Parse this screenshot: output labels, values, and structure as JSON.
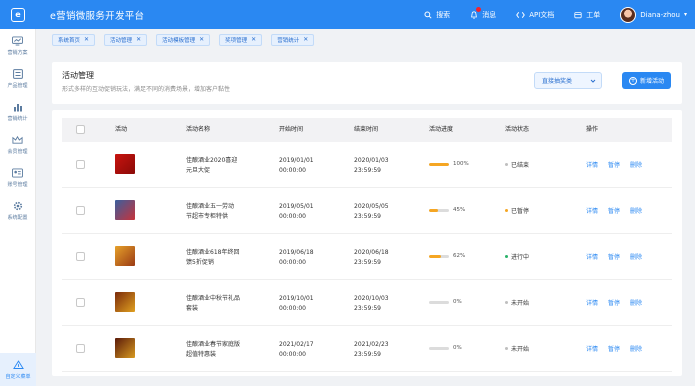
{
  "app": {
    "logo_text": "e",
    "title": "e营销微服务开发平台"
  },
  "topnav": {
    "search": "搜索",
    "messages": "消息",
    "api_docs": "API文档",
    "tickets": "工单",
    "user": "Diana-zhou"
  },
  "sidebar": {
    "items": [
      {
        "label": "营销方案",
        "icon": "chart-monitor-icon"
      },
      {
        "label": "产品管理",
        "icon": "list-icon"
      },
      {
        "label": "营销统计",
        "icon": "bar-chart-icon"
      },
      {
        "label": "会员管理",
        "icon": "crown-icon"
      },
      {
        "label": "账号管理",
        "icon": "user-card-icon"
      },
      {
        "label": "系统配置",
        "icon": "gear-icon"
      }
    ],
    "bottom": {
      "label": "自定义菜单",
      "icon": "custom-menu-icon"
    }
  },
  "tags": [
    "系统首页",
    "活动管理",
    "活动模板管理",
    "奖项管理",
    "营销统计"
  ],
  "header": {
    "title": "活动管理",
    "desc": "形式多样的互动促销玩法，满足不同的消费场景，增加客户黏性",
    "select_value": "直接抽奖类",
    "new_button": "新增活动"
  },
  "table": {
    "columns": [
      "活动",
      "活动名称",
      "开始时间",
      "结束时间",
      "活动进度",
      "活动状态",
      "操作"
    ],
    "actions": [
      "详情",
      "暂停",
      "删除"
    ],
    "rows": [
      {
        "name_line1": "佳酿酒业2020喜迎",
        "name_line2": "元旦大促",
        "start_date": "2019/01/01",
        "start_time": "00:00:00",
        "end_date": "2020/01/03",
        "end_time": "23:59:59",
        "progress": 100,
        "progress_label": "100%",
        "status": "已结束",
        "status_color": "#bfbfbf",
        "thumb": [
          "#c8140f",
          "#8a0a07"
        ]
      },
      {
        "name_line1": "佳酿酒业五一劳动",
        "name_line2": "节超市专柜特供",
        "start_date": "2019/05/01",
        "start_time": "00:00:00",
        "end_date": "2020/05/05",
        "end_time": "23:59:59",
        "progress": 45,
        "progress_label": "45%",
        "status": "已暂停",
        "status_color": "#f5a623",
        "thumb": [
          "#3a5f9e",
          "#c8323a"
        ]
      },
      {
        "name_line1": "佳酿酒业618年终回",
        "name_line2": "馈5折促销",
        "start_date": "2019/06/18",
        "start_time": "00:00:00",
        "end_date": "2020/06/18",
        "end_time": "23:59:59",
        "progress": 62,
        "progress_label": "62%",
        "status": "进行中",
        "status_color": "#2ab26a",
        "thumb": [
          "#e6a12a",
          "#9a3a14"
        ]
      },
      {
        "name_line1": "佳酿酒业中秋节礼品",
        "name_line2": "套装",
        "start_date": "2019/10/01",
        "start_time": "00:00:00",
        "end_date": "2020/10/03",
        "end_time": "23:59:59",
        "progress": 0,
        "progress_label": "0%",
        "status": "未开始",
        "status_color": "#bfbfbf",
        "thumb": [
          "#7a2a0a",
          "#e0a020"
        ]
      },
      {
        "name_line1": "佳酿酒业春节家庭版",
        "name_line2": "超值特惠装",
        "start_date": "2021/02/17",
        "start_time": "00:00:00",
        "end_date": "2021/02/23",
        "end_time": "23:59:59",
        "progress": 0,
        "progress_label": "0%",
        "status": "未开始",
        "status_color": "#bfbfbf",
        "thumb": [
          "#5a1a0a",
          "#d89a20"
        ]
      }
    ]
  },
  "colors": {
    "primary": "#2a88f2",
    "progress": "#f5a623"
  }
}
